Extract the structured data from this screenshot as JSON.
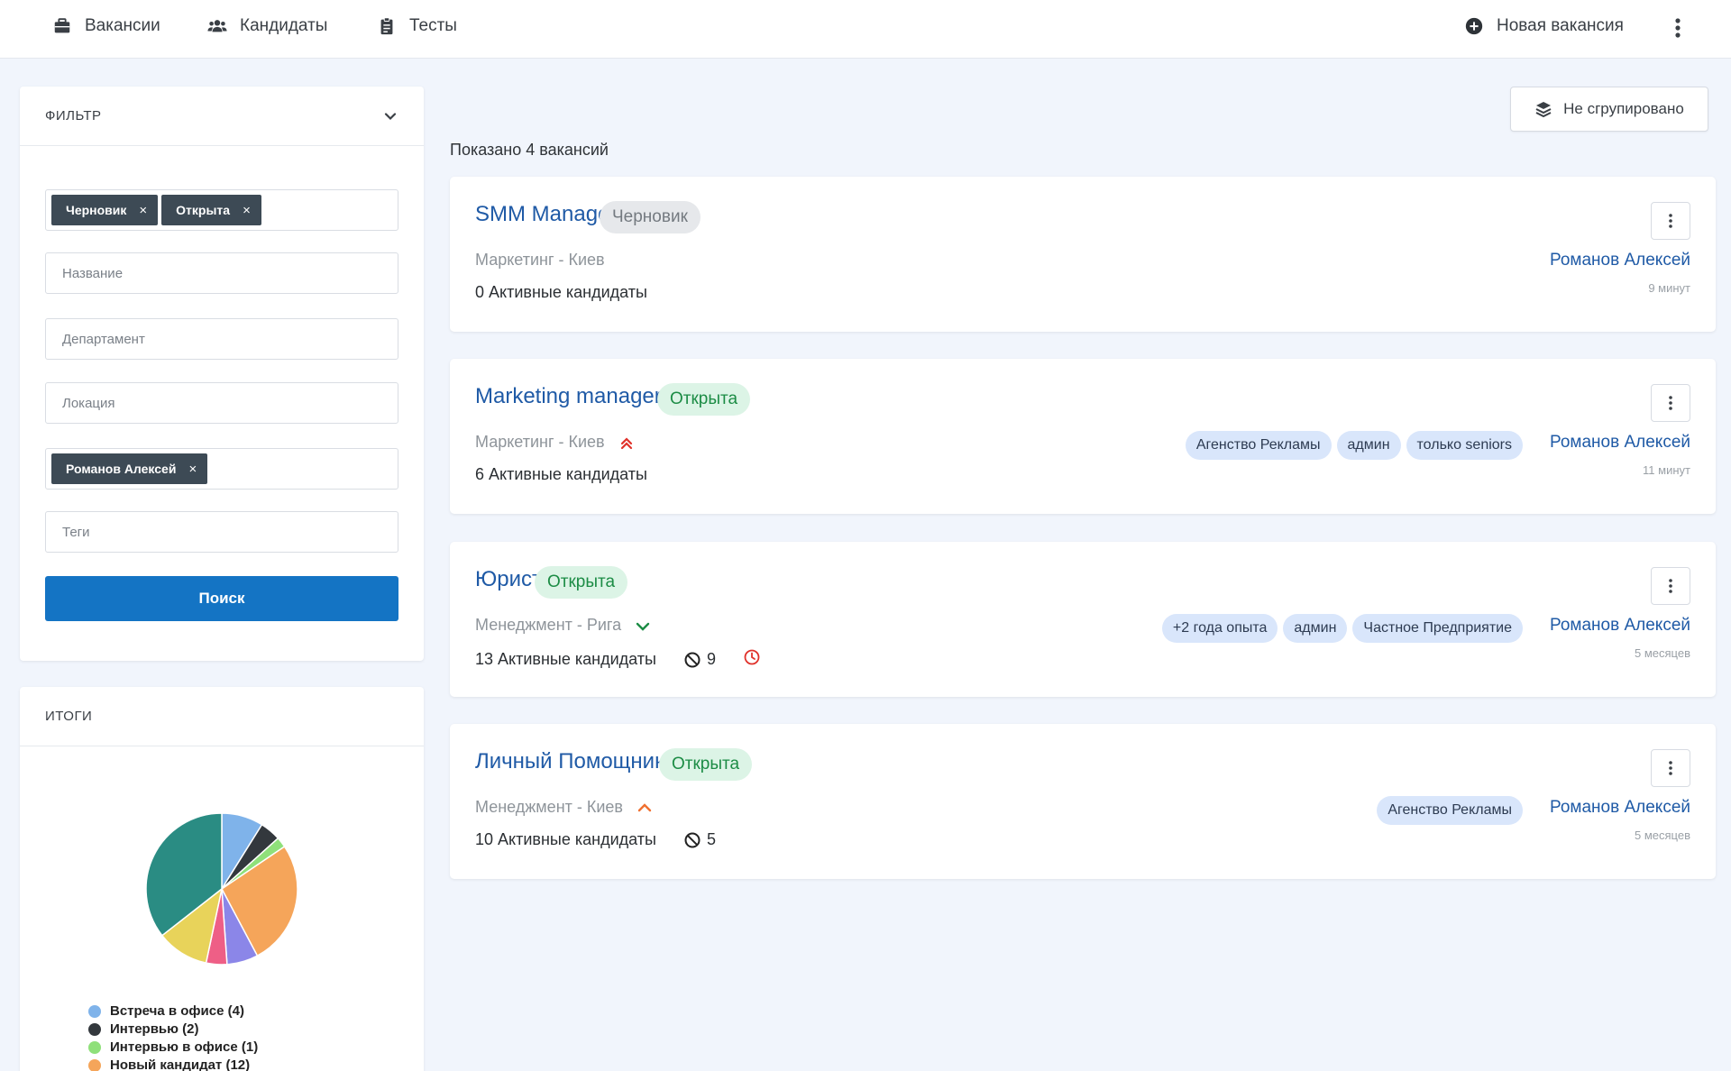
{
  "nav": {
    "items": [
      {
        "label": "Вакансии",
        "icon": "briefcase-icon"
      },
      {
        "label": "Кандидаты",
        "icon": "users-icon"
      },
      {
        "label": "Тесты",
        "icon": "clipboard-icon"
      }
    ],
    "new_vacancy": "Новая вакансия"
  },
  "filter": {
    "title": "Фильтр",
    "status_chips": [
      "Черновик",
      "Открыта"
    ],
    "name_placeholder": "Название",
    "department_placeholder": "Департамент",
    "location_placeholder": "Локация",
    "owner_chip": "Романов Алексей",
    "tags_placeholder": "Теги",
    "search_label": "Поиск"
  },
  "summary": {
    "title": "Итоги",
    "chart_data": {
      "type": "pie",
      "slices": [
        {
          "label": "Встреча в офисе (4)",
          "value": 4,
          "color": "#7fb3ea"
        },
        {
          "label": "Интервью (2)",
          "value": 2,
          "color": "#33383d"
        },
        {
          "label": "Интервью в офисе (1)",
          "value": 1,
          "color": "#8fe07a"
        },
        {
          "label": "Новый кандидат (12)",
          "value": 12,
          "color": "#f5a55a"
        },
        {
          "label": "",
          "value": 3,
          "color": "#8b86e8"
        },
        {
          "label": "",
          "value": 2,
          "color": "#ee5f86"
        },
        {
          "label": "",
          "value": 5,
          "color": "#e8d35a"
        },
        {
          "label": "",
          "value": 16,
          "color": "#2a8c83"
        }
      ]
    }
  },
  "toolbar": {
    "group_label": "Не сгрупировано",
    "shown_text": "Показано 4 вакансий"
  },
  "jobs": [
    {
      "title": "SMM Manager",
      "status": "Черновик",
      "status_kind": "draft",
      "meta": "Маркетинг - Киев",
      "priority_icon": "",
      "candidates": "0 Активные кандидаты",
      "rejected": "",
      "tags": [],
      "owner": "Романов Алексей",
      "ago": "9 минут"
    },
    {
      "title": "Marketing manager",
      "status": "Открыта",
      "status_kind": "open",
      "meta": "Маркетинг - Киев",
      "priority_icon": "double-chevron-up-icon",
      "candidates": "6 Активные кандидаты",
      "rejected": "",
      "tags": [
        "Агенство Рекламы",
        "админ",
        "только seniors"
      ],
      "owner": "Романов Алексей",
      "ago": "11 минут"
    },
    {
      "title": "Юрист",
      "status": "Открыта",
      "status_kind": "open",
      "meta": "Менеджмент - Рига",
      "priority_icon": "chevron-down-icon",
      "candidates": "13 Активные кандидаты",
      "rejected": "9",
      "overdue": true,
      "tags": [
        "+2 года опыта",
        "админ",
        "Частное Предприятие"
      ],
      "owner": "Романов Алексей",
      "ago": "5 месяцев"
    },
    {
      "title": "Личный Помощник",
      "status": "Открыта",
      "status_kind": "open",
      "meta": "Менеджмент - Киев",
      "priority_icon": "chevron-up-icon",
      "candidates": "10 Активные кандидаты",
      "rejected": "5",
      "tags": [
        "Агенство Рекламы"
      ],
      "owner": "Романов Алексей",
      "ago": "5 месяцев"
    }
  ],
  "colors": {
    "accent": "#1474c4",
    "link": "#1f5aa6",
    "open": "#1c8c45",
    "chip": "#3d4a55"
  }
}
